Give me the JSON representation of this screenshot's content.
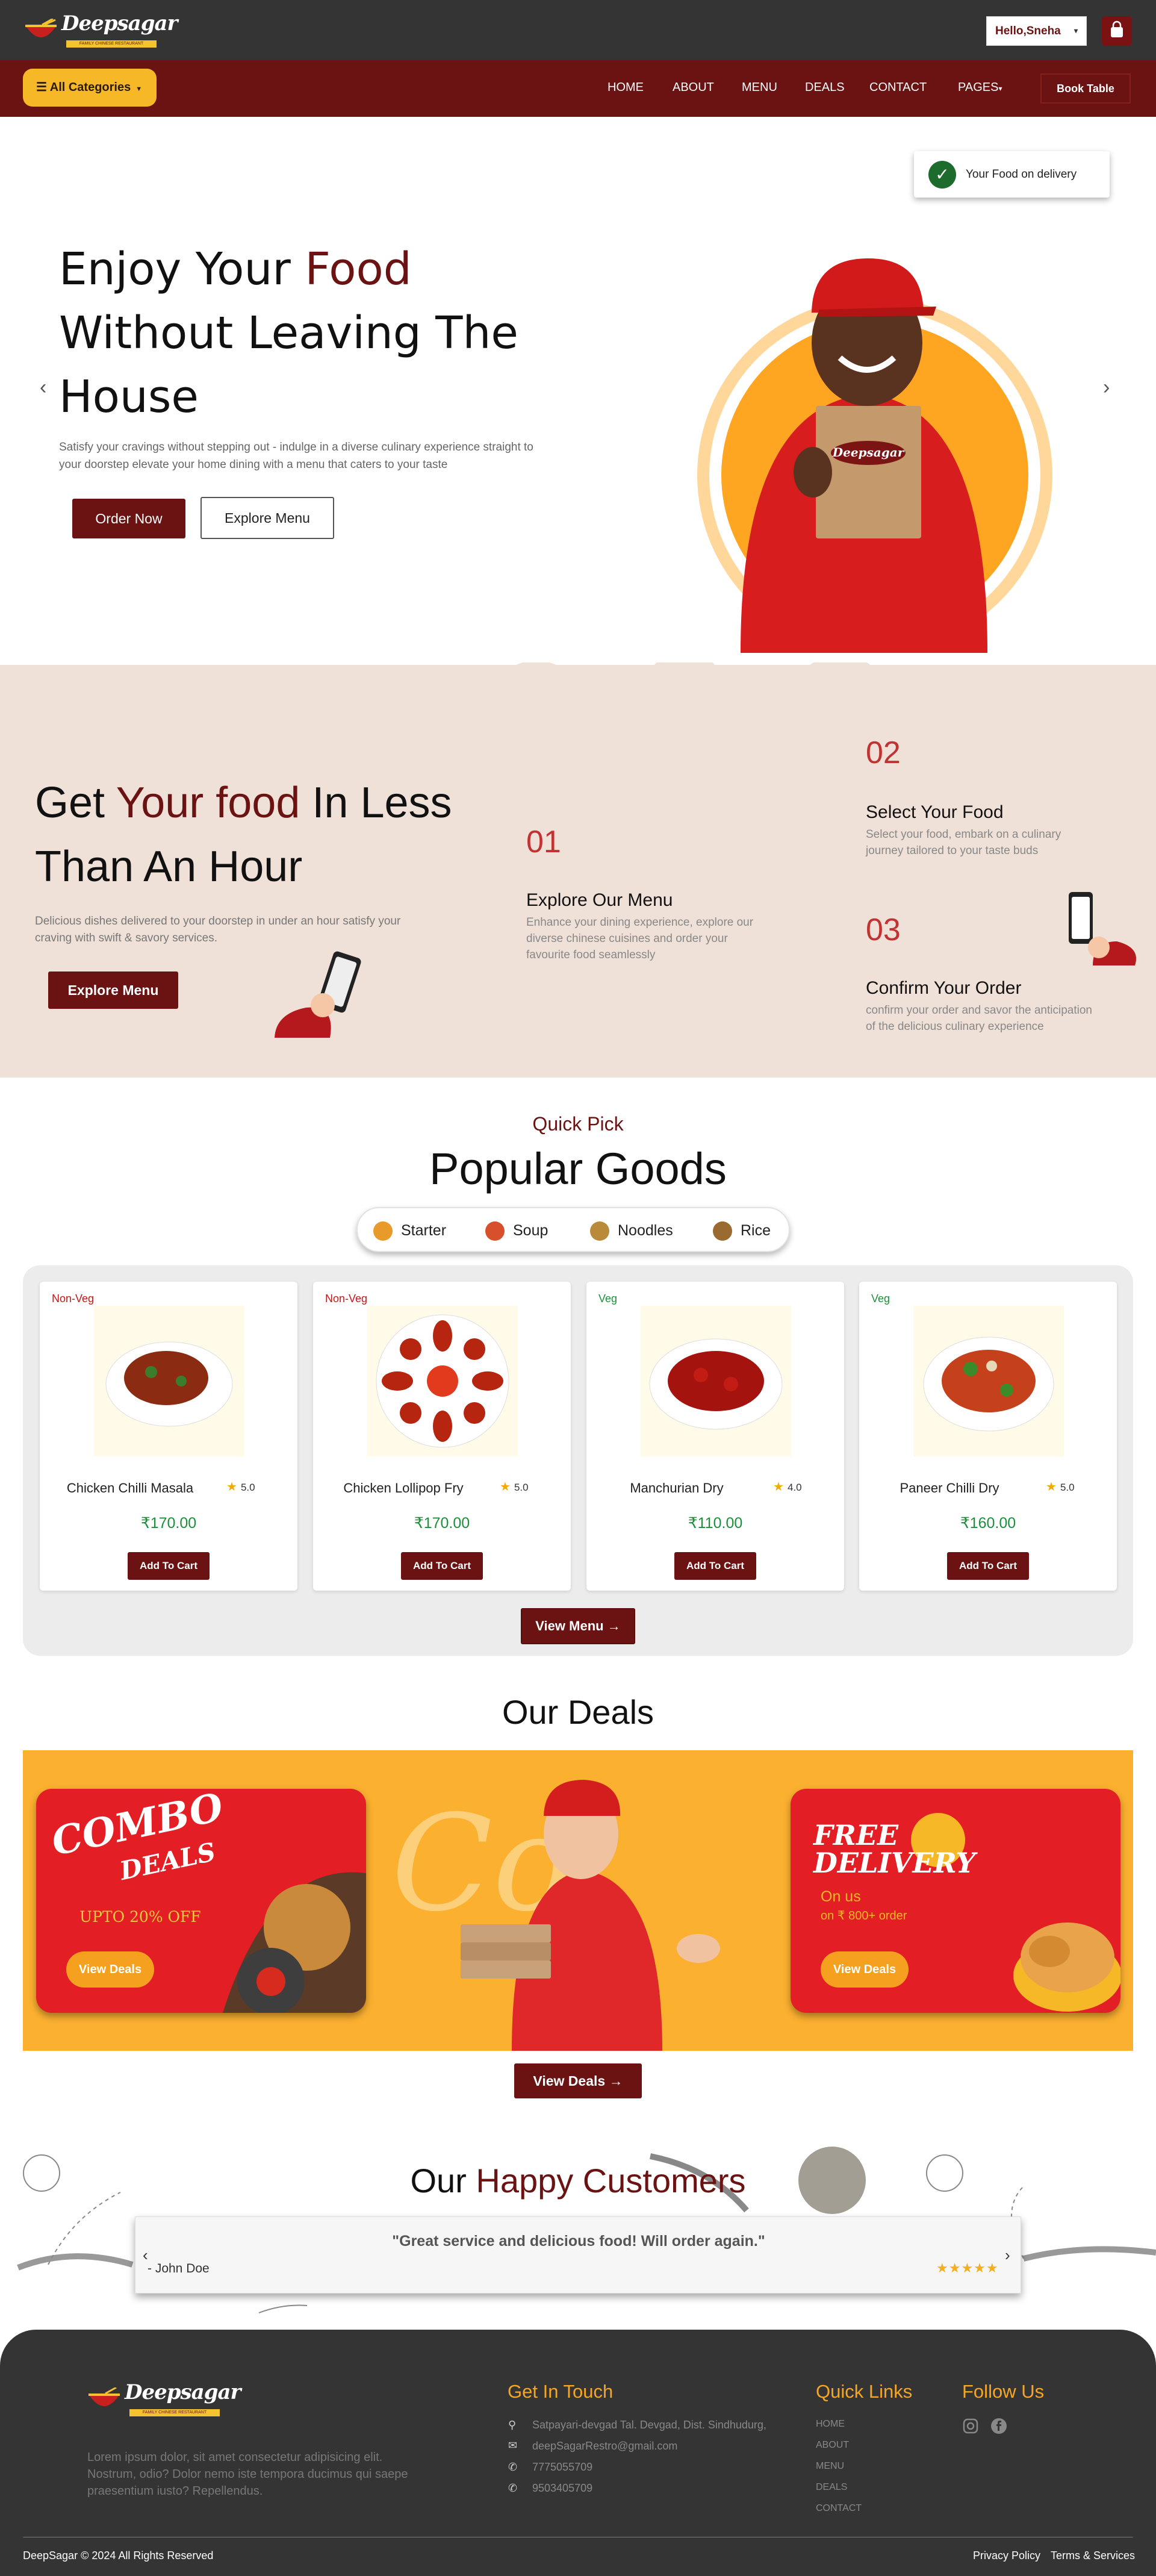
{
  "brand": {
    "name": "Deepsagar",
    "tagline": "FAMILY CHINESE RESTAURANT"
  },
  "header": {
    "user_label": "Hello,Sneha",
    "user_caret": "▾"
  },
  "nav": {
    "categories_label": "All Categories",
    "items": [
      "HOME",
      "ABOUT",
      "MENU",
      "DEALS",
      "CONTACT",
      "PAGES"
    ],
    "pages_caret": "▾",
    "book_label": "Book Table"
  },
  "hero": {
    "title_pre": "Enjoy Your ",
    "title_accent": "Food",
    "title_post": " Without Leaving The House",
    "subtitle": "Satisfy your cravings without stepping out - indulge in a diverse culinary experience straight to your doorstep elevate your home dining with a menu that caters to your taste",
    "order_label": "Order Now",
    "explore_label": "Explore Menu",
    "delivery_badge": "Your Food on delivery",
    "prev": "‹",
    "next": "›"
  },
  "howto": {
    "title_pre": "Get ",
    "title_accent": "Your food",
    "title_post": " In Less Than An Hour",
    "subtitle": "Delicious dishes delivered to your doorstep in under an hour satisfy your craving with swift & savory services.",
    "button_label": "Explore Menu",
    "steps": [
      {
        "num": "01",
        "title": "Explore Our Menu",
        "text": "Enhance your dining experience, explore our diverse chinese cuisines and order your favourite food seamlessly"
      },
      {
        "num": "02",
        "title": "Select Your Food",
        "text": "Select your food, embark on a culinary journey tailored to your taste buds"
      },
      {
        "num": "03",
        "title": "Confirm Your Order",
        "text": "confirm your order and savor the anticipation of the delicious culinary experience"
      }
    ]
  },
  "popular": {
    "subtitle": "Quick Pick",
    "title": "Popular Goods",
    "tabs": [
      "Starter",
      "Soup",
      "Noodles",
      "Rice"
    ],
    "products": [
      {
        "badge": "Non-Veg",
        "name": "Chicken Chilli Masala",
        "rating": "5.0",
        "price": "₹170.00",
        "cart": "Add To Cart"
      },
      {
        "badge": "Non-Veg",
        "name": "Chicken Lollipop Fry",
        "rating": "5.0",
        "price": "₹170.00",
        "cart": "Add To Cart"
      },
      {
        "badge": "Veg",
        "name": "Manchurian Dry",
        "rating": "4.0",
        "price": "₹110.00",
        "cart": "Add To Cart"
      },
      {
        "badge": "Veg",
        "name": "Paneer Chilli Dry",
        "rating": "5.0",
        "price": "₹160.00",
        "cart": "Add To Cart"
      }
    ],
    "view_menu": "View Menu"
  },
  "deals": {
    "title": "Our Deals",
    "combo_title": "COMBO",
    "combo_sub": "DEALS",
    "combo_offer": "UPTO 20% OFF",
    "free_title": "FREE",
    "free_sub": "DELIVERY",
    "free_on": "On us",
    "free_cond": "on ₹ 800+ order",
    "deal_btn": "View Deals",
    "view_deals": "View Deals"
  },
  "customers": {
    "title_pre": "Our ",
    "title_accent": "Happy Customers",
    "quote": "\"Great service and delicious food! Will order again.\"",
    "author": "- John Doe",
    "stars": "★★★★★",
    "prev": "‹",
    "next": "›"
  },
  "footer": {
    "lorem": "Lorem ipsum dolor, sit amet consectetur adipisicing elit. Nostrum, odio? Dolor nemo iste tempora ducimus qui saepe praesentium iusto? Repellendus.",
    "contact_head": "Get In Touch",
    "address": "Satpayari-devgad Tal. Devgad, Dist. Sindhudurg,",
    "email": "deepSagarRestro@gmail.com",
    "phone1": "7775055709",
    "phone2": "9503405709",
    "links_head": "Quick Links",
    "links": [
      "HOME",
      "ABOUT",
      "MENU",
      "DEALS",
      "CONTACT"
    ],
    "follow_head": "Follow Us",
    "copyright": "DeepSagar © 2024 All Rights Reserved",
    "privacy": "Privacy Policy",
    "terms": "Terms & Services"
  },
  "colors": {
    "maroon": "#6b1212",
    "amber": "#f6b826",
    "dark": "#343434",
    "orange": "#fbb030",
    "red": "#e31e24",
    "green": "#1c8f3a"
  }
}
